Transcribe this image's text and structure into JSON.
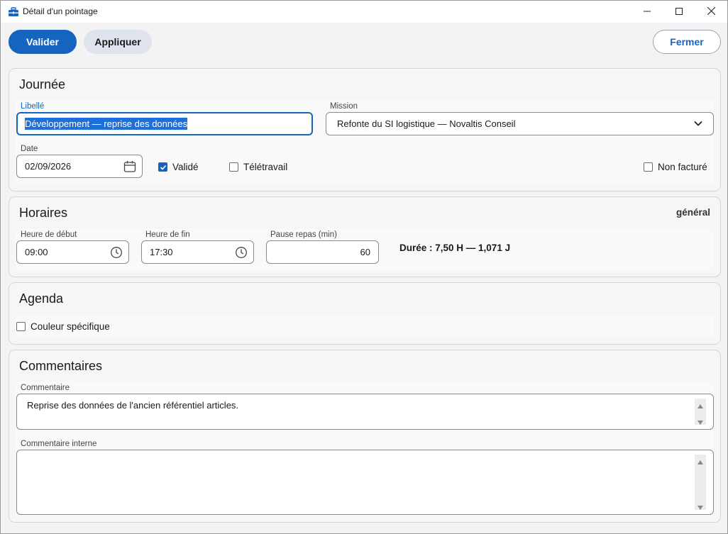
{
  "window": {
    "title": "Détail d'un pointage"
  },
  "toolbar": {
    "validate_label": "Valider",
    "apply_label": "Appliquer",
    "close_label": "Fermer"
  },
  "journee": {
    "title": "Journée",
    "libelle_label": "Libellé",
    "libelle_value": "Développement — reprise des données",
    "mission_label": "Mission",
    "mission_value": "Refonte du SI logistique — Novaltis Conseil",
    "date_label": "Date",
    "date_value": "02/09/2026",
    "valide_label": "Validé",
    "valide_checked": true,
    "teletravail_label": "Télétravail",
    "teletravail_checked": false,
    "non_facture_label": "Non facturé",
    "non_facture_checked": false
  },
  "horaires": {
    "title": "Horaires",
    "badge": "général",
    "start_label": "Heure de début",
    "start_value": "09:00",
    "end_label": "Heure de fin",
    "end_value": "17:30",
    "pause_label": "Pause repas (min)",
    "pause_value": "60",
    "duration": "Durée : 7,50 H — 1,071 J"
  },
  "agenda": {
    "title": "Agenda",
    "color_label": "Couleur spécifique",
    "color_checked": false
  },
  "commentaires": {
    "title": "Commentaires",
    "comment_label": "Commentaire",
    "comment_value": "Reprise des données de l'ancien référentiel articles.",
    "internal_label": "Commentaire interne",
    "internal_value": ""
  },
  "colors": {
    "accent": "#1565c0",
    "secondary_button": "#dfe3ec"
  },
  "icons": {
    "app": "toolbox-icon",
    "minimize": "minimize-icon",
    "maximize": "maximize-icon",
    "close": "close-icon",
    "mission_dropdown": "chevron-down-icon",
    "date": "calendar-icon",
    "time": "clock-icon",
    "scroll_up": "scroll-up-arrow-icon",
    "scroll_down": "scroll-down-arrow-icon"
  }
}
